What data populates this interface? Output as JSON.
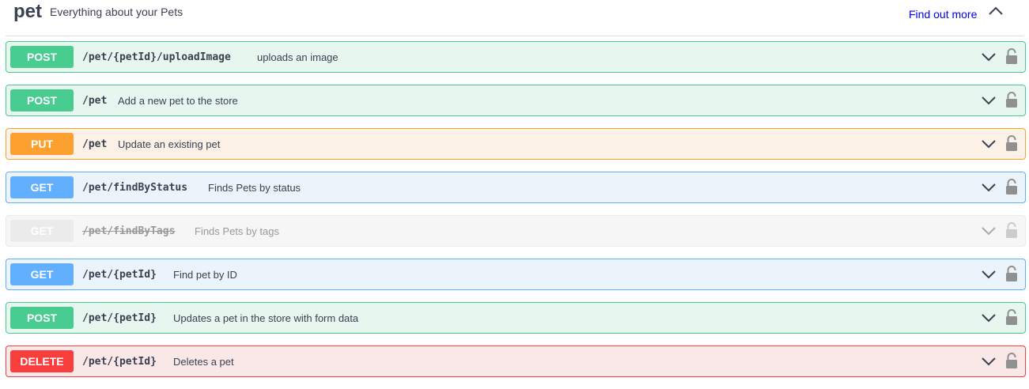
{
  "tag": {
    "name": "pet",
    "description": "Everything about your Pets",
    "find_out_more": "Find out more",
    "collapse_icon": "chevron-up-icon"
  },
  "colors": {
    "post": "#49cc90",
    "put": "#fca130",
    "get": "#61affe",
    "delete": "#f93e3e",
    "deprecated": "#ebebeb"
  },
  "operations": [
    {
      "method": "POST",
      "path": "/pet/{petId}/uploadImage",
      "summary": "uploads an image",
      "deprecated": false
    },
    {
      "method": "POST",
      "path": "/pet",
      "summary": "Add a new pet to the store",
      "deprecated": false
    },
    {
      "method": "PUT",
      "path": "/pet",
      "summary": "Update an existing pet",
      "deprecated": false
    },
    {
      "method": "GET",
      "path": "/pet/findByStatus",
      "summary": "Finds Pets by status",
      "deprecated": false
    },
    {
      "method": "GET",
      "path": "/pet/findByTags",
      "summary": "Finds Pets by tags",
      "deprecated": true
    },
    {
      "method": "GET",
      "path": "/pet/{petId}",
      "summary": "Find pet by ID",
      "deprecated": false
    },
    {
      "method": "POST",
      "path": "/pet/{petId}",
      "summary": "Updates a pet in the store with form data",
      "deprecated": false
    },
    {
      "method": "DELETE",
      "path": "/pet/{petId}",
      "summary": "Deletes a pet",
      "deprecated": false
    }
  ],
  "icons": {
    "expand": "chevron-down-icon",
    "auth": "lock-icon"
  }
}
